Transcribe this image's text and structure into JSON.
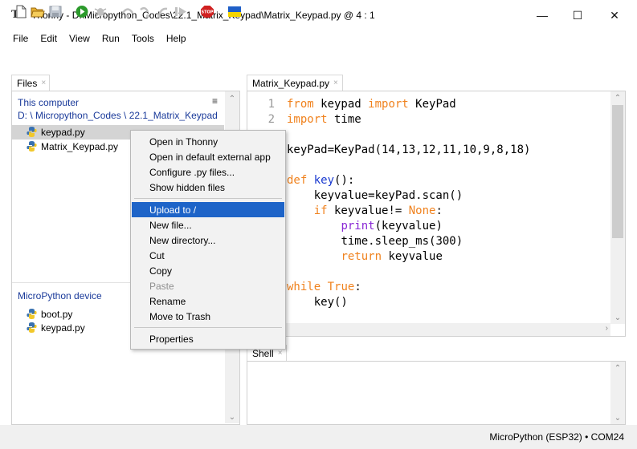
{
  "window": {
    "app_icon": "Tk",
    "title": "Thonny  -  D:\\Micropython_Codes\\22.1_Matrix_Keypad\\Matrix_Keypad.py  @  4 : 1",
    "controls": {
      "minimize": "—",
      "maximize": "☐",
      "close": "✕"
    }
  },
  "menu": [
    "File",
    "Edit",
    "View",
    "Run",
    "Tools",
    "Help"
  ],
  "toolbar": {
    "icons": [
      "new-file-icon",
      "open-file-icon",
      "save-file-icon",
      "run-icon",
      "debug-icon",
      "step-over-icon",
      "step-into-icon",
      "step-out-icon",
      "resume-icon",
      "stop-icon",
      "ukraine-flag-icon"
    ],
    "stop_label": "STOP",
    "colors": {
      "run": "#2c9a2c",
      "stop": "#d02020",
      "flag_top": "#1f5fc8",
      "flag_bottom": "#f5d400"
    }
  },
  "files": {
    "tab_label": "Files",
    "tab_close": "×",
    "computer_label": "This computer",
    "computer_path": "D: \\ Micropython_Codes \\ 22.1_Matrix_Keypad",
    "menu_icon": "≡",
    "computer_files": [
      "keypad.py",
      "Matrix_Keypad.py"
    ],
    "device_label": "MicroPython device",
    "device_files": [
      "boot.py",
      "keypad.py"
    ]
  },
  "editor": {
    "tab_label": "Matrix_Keypad.py",
    "tab_close": "×",
    "line_numbers": [
      "1",
      "2"
    ],
    "lines": [
      {
        "indent": "",
        "parts": [
          {
            "t": "from",
            "c": "kw"
          },
          {
            "t": " keypad ",
            "c": ""
          },
          {
            "t": "import",
            "c": "kw"
          },
          {
            "t": " KeyPad",
            "c": ""
          }
        ]
      },
      {
        "indent": "",
        "parts": [
          {
            "t": "import",
            "c": "kw"
          },
          {
            "t": " time",
            "c": ""
          }
        ]
      },
      {
        "indent": "",
        "parts": []
      },
      {
        "indent": "",
        "parts": [
          {
            "t": "keyPad=KeyPad(14,13,12,11,10,9,8,18)",
            "c": ""
          }
        ]
      },
      {
        "indent": "",
        "parts": []
      },
      {
        "indent": "",
        "parts": [
          {
            "t": "def",
            "c": "kw"
          },
          {
            "t": " ",
            "c": ""
          },
          {
            "t": "key",
            "c": "fn"
          },
          {
            "t": "():",
            "c": ""
          }
        ]
      },
      {
        "indent": "    ",
        "parts": [
          {
            "t": "keyvalue=keyPad.scan()",
            "c": ""
          }
        ]
      },
      {
        "indent": "    ",
        "parts": [
          {
            "t": "if",
            "c": "kw"
          },
          {
            "t": " keyvalue!= ",
            "c": ""
          },
          {
            "t": "None",
            "c": "kw"
          },
          {
            "t": ":",
            "c": ""
          }
        ]
      },
      {
        "indent": "        ",
        "parts": [
          {
            "t": "print",
            "c": "bi"
          },
          {
            "t": "(keyvalue)",
            "c": ""
          }
        ]
      },
      {
        "indent": "        ",
        "parts": [
          {
            "t": "time.sleep_ms(300)",
            "c": ""
          }
        ]
      },
      {
        "indent": "        ",
        "parts": [
          {
            "t": "return",
            "c": "kw"
          },
          {
            "t": " keyvalue",
            "c": ""
          }
        ]
      },
      {
        "indent": "",
        "parts": []
      },
      {
        "indent": "",
        "parts": [
          {
            "t": "while",
            "c": "kw"
          },
          {
            "t": " ",
            "c": ""
          },
          {
            "t": "True",
            "c": "kw"
          },
          {
            "t": ":",
            "c": ""
          }
        ]
      },
      {
        "indent": "    ",
        "parts": [
          {
            "t": "key()",
            "c": ""
          }
        ]
      }
    ]
  },
  "shell": {
    "tab_label": "Shell",
    "tab_close": "×"
  },
  "status": {
    "text": "MicroPython (ESP32)  •  COM24"
  },
  "context_menu": {
    "groups": [
      [
        {
          "label": "Open in Thonny"
        },
        {
          "label": "Open in default external app"
        },
        {
          "label": "Configure .py files..."
        },
        {
          "label": "Show hidden files"
        }
      ],
      [
        {
          "label": "Upload to /",
          "highlight": true
        },
        {
          "label": "New file..."
        },
        {
          "label": "New directory..."
        },
        {
          "label": "Cut"
        },
        {
          "label": "Copy"
        },
        {
          "label": "Paste",
          "disabled": true
        },
        {
          "label": "Rename"
        },
        {
          "label": "Move to Trash"
        }
      ],
      [
        {
          "label": "Properties"
        }
      ]
    ]
  },
  "colors": {
    "link_blue": "#1a3a9a",
    "keyword": "#f0821e",
    "function": "#1a3ad0",
    "builtin": "#8a2ad6",
    "menu_highlight": "#1e64c8"
  }
}
